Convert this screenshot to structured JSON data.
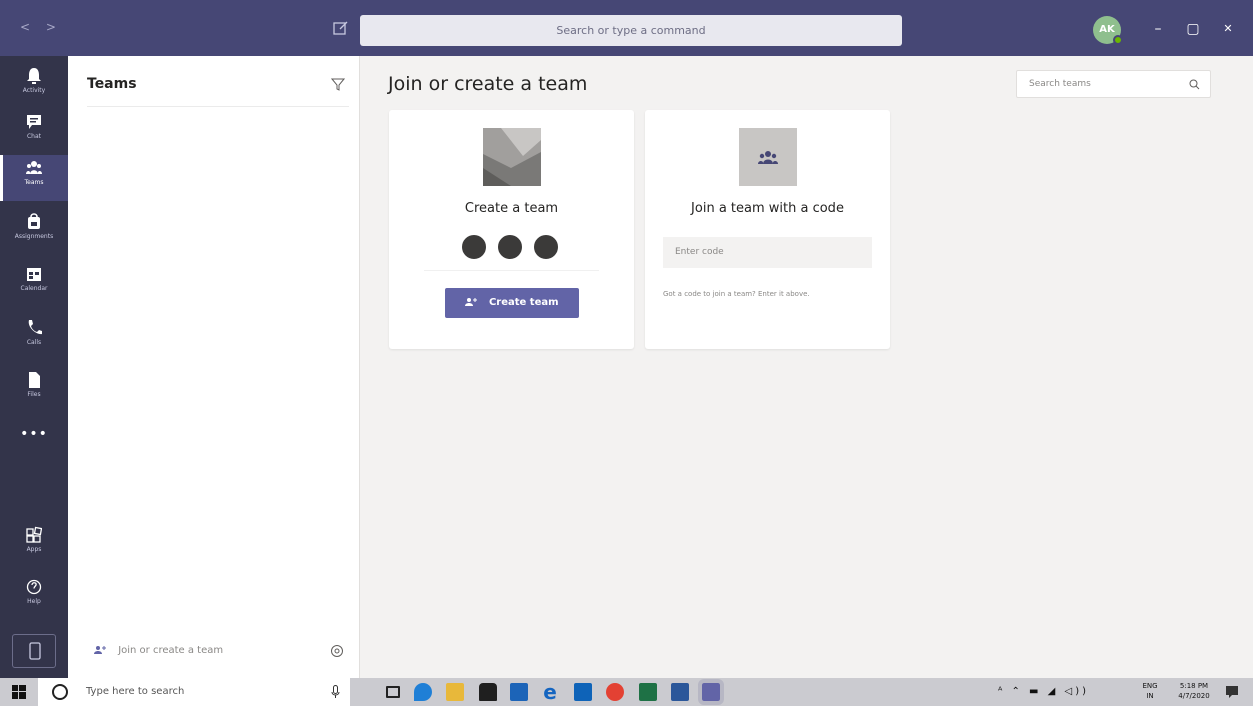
{
  "titlebar": {
    "search_placeholder": "Search or type a command",
    "avatar_initials": "AK",
    "minimize": "–",
    "maximize": "▢",
    "close": "✕",
    "accent": "#464775"
  },
  "rail": {
    "items": [
      {
        "label": "Activity",
        "icon": "bell-icon"
      },
      {
        "label": "Chat",
        "icon": "chat-icon"
      },
      {
        "label": "Teams",
        "icon": "teams-icon",
        "active": true
      },
      {
        "label": "Assignments",
        "icon": "assignments-icon"
      },
      {
        "label": "Calendar",
        "icon": "calendar-icon"
      },
      {
        "label": "Calls",
        "icon": "phone-icon"
      },
      {
        "label": "Files",
        "icon": "files-icon"
      }
    ],
    "more": "•••",
    "bottom": [
      {
        "label": "Apps",
        "icon": "apps-icon"
      },
      {
        "label": "Help",
        "icon": "help-icon"
      }
    ]
  },
  "panel": {
    "title": "Teams",
    "join_label": "Join or create a team"
  },
  "main": {
    "title": "Join or create a team",
    "search_placeholder": "Search teams",
    "create_card": {
      "title": "Create a team",
      "button": "Create team"
    },
    "join_card": {
      "title": "Join a team with a code",
      "placeholder": "Enter code",
      "hint": "Got a code to join a team? Enter it above."
    },
    "button_color": "#6264a7"
  },
  "taskbar": {
    "search_placeholder": "Type here to search",
    "lang_line1": "ENG",
    "lang_line2": "IN",
    "time": "5:18 PM",
    "date": "4/7/2020",
    "tray_symbols": "ᴬ ⌃ ▬ ◢ ◁))"
  }
}
